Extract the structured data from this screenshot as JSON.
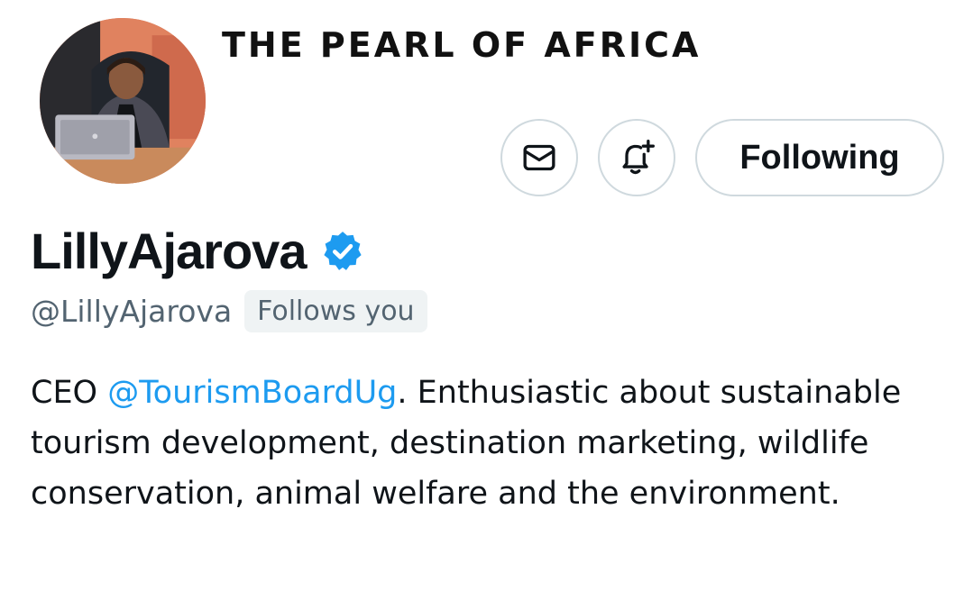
{
  "banner": {
    "tagline": "THE PEARL OF AFRICA"
  },
  "profile": {
    "display_name": "LillyAjarova",
    "handle": "@LillyAjarova",
    "follows_you_label": "Follows you",
    "verified_icon": "verified-badge-icon",
    "bio": {
      "prefix": "CEO ",
      "mention": "@TourismBoardUg",
      "rest": ". Enthusiastic about sustainable tourism development, destination marketing, wildlife conservation, animal welfare and the environment."
    }
  },
  "actions": {
    "message_icon": "envelope-icon",
    "notify_icon": "bell-plus-icon",
    "following_label": "Following"
  },
  "colors": {
    "accent": "#1d9bf0",
    "text_primary": "#0f1419",
    "text_secondary": "#536471",
    "border": "#cfd9de",
    "badge_bg": "#eff3f4"
  }
}
